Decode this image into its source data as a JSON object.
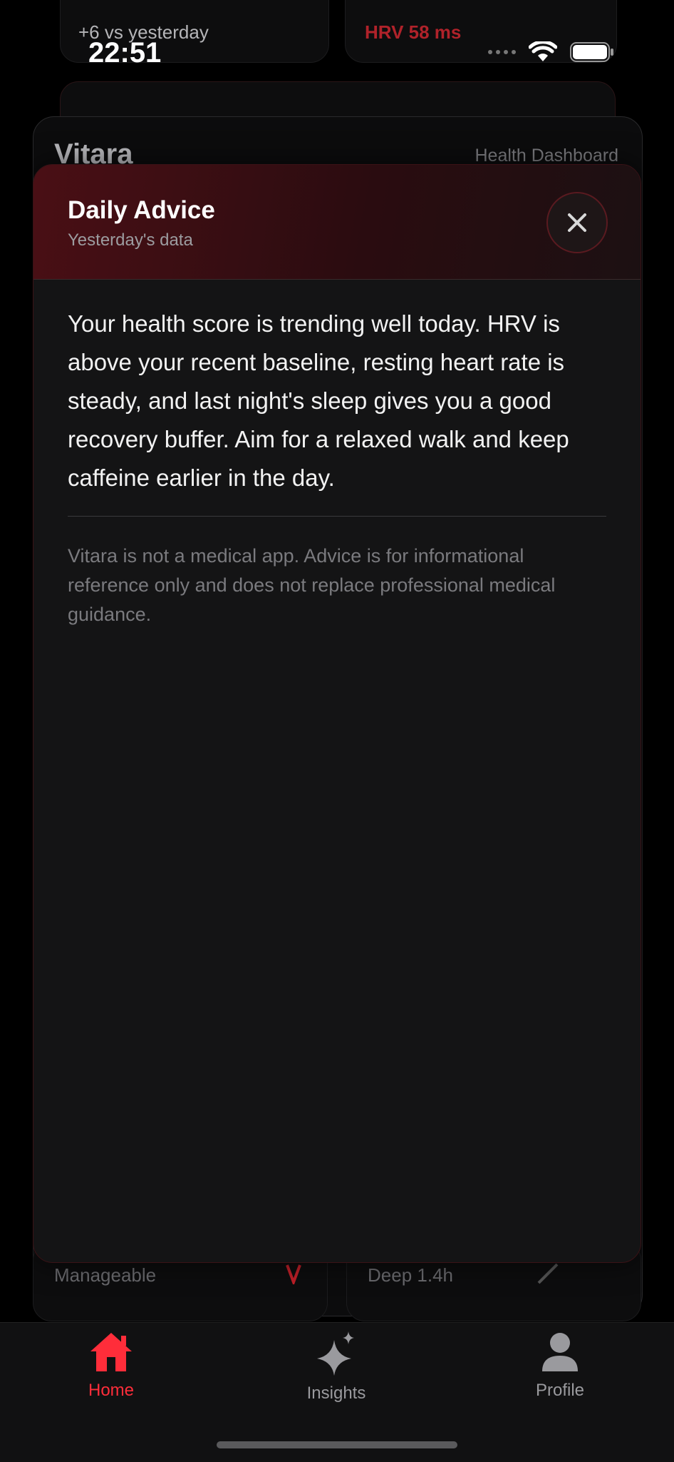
{
  "status_bar": {
    "time": "22:51"
  },
  "background": {
    "card_left_delta": "+6 vs yesterday",
    "card_right_metric": "HRV 58 ms",
    "sheet_title": "Vitara",
    "sheet_subtitle": "Health Dashboard",
    "peek_left_label": "Manageable",
    "peek_right_label": "Deep 1.4h"
  },
  "modal": {
    "title": "Daily Advice",
    "subtitle": "Yesterday's data",
    "advice": "Your health score is trending well today. HRV is above your recent baseline, resting heart rate is steady, and last night's sleep gives you a good recovery buffer. Aim for a relaxed walk and keep caffeine earlier in the day.",
    "disclaimer": "Vitara is not a medical app. Advice is for informational reference only and does not replace professional medical guidance."
  },
  "tabs": [
    {
      "label": "Home",
      "icon": "home-icon",
      "active": true
    },
    {
      "label": "Insights",
      "icon": "sparkles-icon",
      "active": false
    },
    {
      "label": "Profile",
      "icon": "person-icon",
      "active": false
    }
  ],
  "colors": {
    "accent": "#ff2d3a",
    "inactive": "#9a9a9e"
  }
}
